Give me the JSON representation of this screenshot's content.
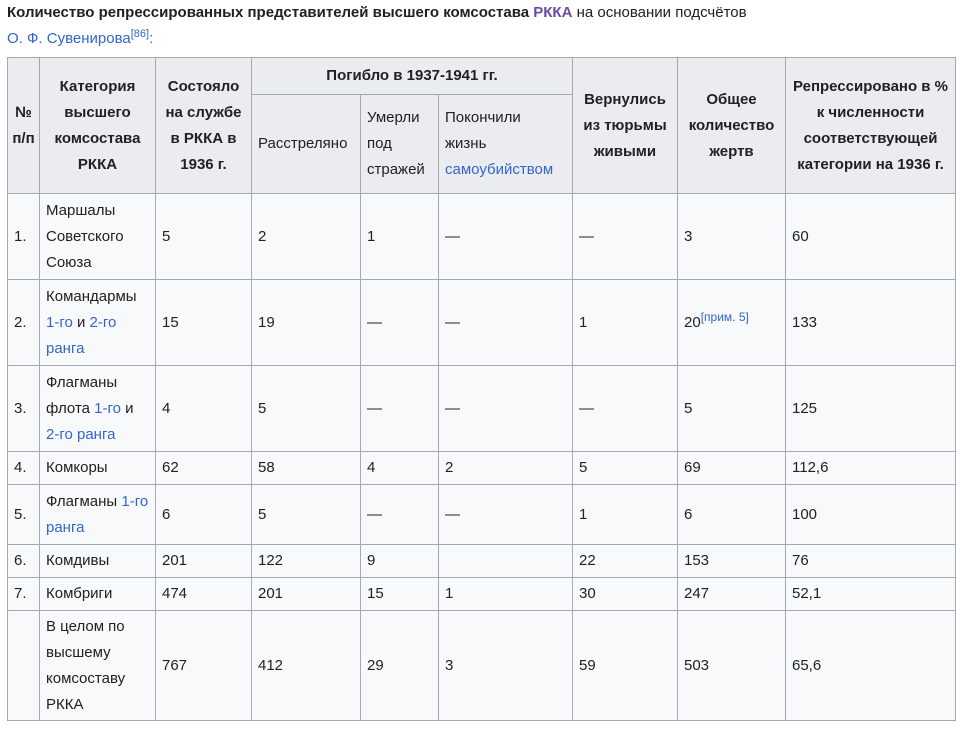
{
  "caption": {
    "text_before": "Количество репрессированных представителей высшего комсостава ",
    "link_rkka": "РККА",
    "text_after": " на основании подсчётов",
    "author_link": "О. Ф. Сувенирова",
    "ref": "[86]",
    "colon": ":"
  },
  "header": {
    "num": "№ п/п",
    "category": "Категория высшего комсостава РККА",
    "in_service": "Состояло на службе в РККА в 1936 г.",
    "died_group": "Погибло в 1937-1941 гг.",
    "shot": "Расстреляно",
    "died_custody": "Умерли под стражей",
    "suicide_prefix": "Покончили жизнь",
    "suicide_link": "самоубийством",
    "returned": "Вернулись из тюрьмы живыми",
    "total": "Общее количество жертв",
    "percent": "Репрессировано в % к численности соответствующей категории на 1936 г."
  },
  "rows": [
    {
      "num": "1.",
      "cat": {
        "a": "Маршалы Советского Союза"
      },
      "in_service": "5",
      "shot": "2",
      "died": "1",
      "suicide": "—",
      "returned": "—",
      "total": "3",
      "percent": "60"
    },
    {
      "num": "2.",
      "cat": {
        "a": "Командармы ",
        "l1": "1-го",
        "b": " и ",
        "l2": "2-го ранга"
      },
      "in_service": "15",
      "shot": "19",
      "died": "—",
      "suicide": "—",
      "returned": "1",
      "total": "20",
      "note": "[прим. 5]",
      "percent": "133"
    },
    {
      "num": "3.",
      "cat": {
        "a": "Флагманы флота ",
        "l1": "1-го",
        "b": " и ",
        "l2": "2-го ранга"
      },
      "in_service": "4",
      "shot": "5",
      "died": "—",
      "suicide": "—",
      "returned": "—",
      "total": "5",
      "percent": "125"
    },
    {
      "num": "4.",
      "cat": {
        "a": "Комкоры"
      },
      "in_service": "62",
      "shot": "58",
      "died": "4",
      "suicide": "2",
      "returned": "5",
      "total": "69",
      "percent": "112,6"
    },
    {
      "num": "5.",
      "cat": {
        "a": "Флагманы ",
        "l1": "1-го ранга"
      },
      "in_service": "6",
      "shot": "5",
      "died": "—",
      "suicide": "—",
      "returned": "1",
      "total": "6",
      "percent": "100"
    },
    {
      "num": "6.",
      "cat": {
        "a": "Комдивы"
      },
      "in_service": "201",
      "shot": "122",
      "died": "9",
      "suicide": "",
      "returned": "22",
      "total": "153",
      "percent": "76"
    },
    {
      "num": "7.",
      "cat": {
        "a": "Комбриги"
      },
      "in_service": "474",
      "shot": "201",
      "died": "15",
      "suicide": "1",
      "returned": "30",
      "total": "247",
      "percent": "52,1"
    },
    {
      "num": "",
      "cat": {
        "a": "В целом по высшему комсоставу РККА"
      },
      "in_service": "767",
      "shot": "412",
      "died": "29",
      "suicide": "3",
      "returned": "59",
      "total": "503",
      "percent": "65,6"
    }
  ]
}
